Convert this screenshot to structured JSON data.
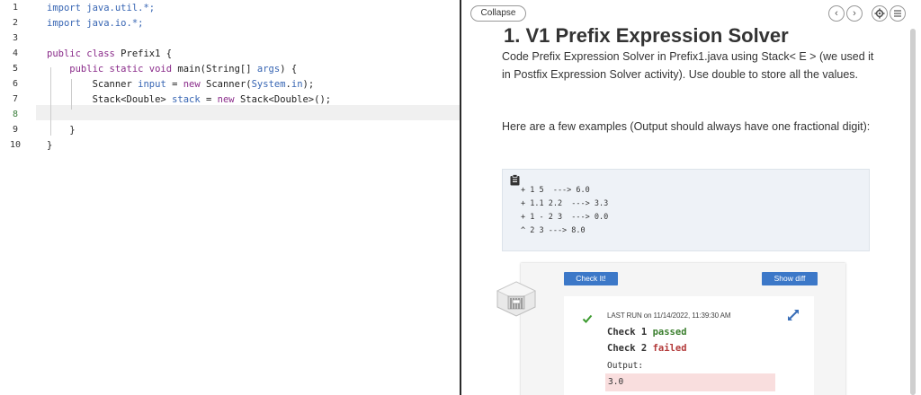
{
  "editor": {
    "line_numbers": [
      "1",
      "2",
      "3",
      "4",
      "5",
      "6",
      "7",
      "8",
      "9",
      "10"
    ],
    "active_line": "8",
    "lines": [
      [
        {
          "t": "import java.util.*;",
          "c": "id"
        }
      ],
      [
        {
          "t": "import java.io.*;",
          "c": "id"
        }
      ],
      [],
      [
        {
          "t": "public class",
          "c": "kw"
        },
        {
          "t": " Prefix1 {",
          "c": ""
        }
      ],
      [
        {
          "t": "    public static void",
          "c": "kw"
        },
        {
          "t": " main(String[] ",
          "c": ""
        },
        {
          "t": "args",
          "c": "id"
        },
        {
          "t": ") {",
          "c": ""
        }
      ],
      [
        {
          "t": "        Scanner ",
          "c": ""
        },
        {
          "t": "input",
          "c": "id"
        },
        {
          "t": " = ",
          "c": ""
        },
        {
          "t": "new",
          "c": "kw"
        },
        {
          "t": " Scanner(",
          "c": ""
        },
        {
          "t": "System",
          "c": "id"
        },
        {
          "t": ".",
          "c": ""
        },
        {
          "t": "in",
          "c": "id"
        },
        {
          "t": ");",
          "c": ""
        }
      ],
      [
        {
          "t": "        Stack<Double> ",
          "c": ""
        },
        {
          "t": "stack",
          "c": "id"
        },
        {
          "t": " = ",
          "c": ""
        },
        {
          "t": "new",
          "c": "kw"
        },
        {
          "t": " Stack<Double>();",
          "c": ""
        }
      ],
      [],
      [
        {
          "t": "    }",
          "c": ""
        }
      ],
      [
        {
          "t": "}",
          "c": ""
        }
      ]
    ]
  },
  "panel": {
    "collapse_label": "Collapse",
    "nav_prev": "‹",
    "nav_next": "›",
    "title": "1. V1 Prefix Expression Solver",
    "description": "Code Prefix Expression Solver in Prefix1.java using Stack< E > (we used it in Postfix Expression Solver activity). Use double to store all the values.",
    "examples_intro": "Here are a few examples (Output should always have one fractional digit):",
    "examples": [
      "+ 1 5  ---> 6.0",
      "+ 1.1 2.2  ---> 3.3",
      "+ 1 - 2 3  ---> 0.0",
      "^ 2 3 ---> 8.0"
    ],
    "check_button": "Check It!",
    "diff_button": "Show diff",
    "last_run_label": "LAST RUN on 11/14/2022, 11:39:30 AM",
    "results": [
      {
        "label": "Check 1",
        "status": "passed"
      },
      {
        "label": "Check 2",
        "status": "failed"
      }
    ],
    "output_label": "Output:",
    "output_value": "3.0"
  },
  "colors": {
    "accent_button": "#3c78c8",
    "pass": "#3b7f2e",
    "fail": "#b33a3a",
    "keyword": "#8a2b8a",
    "identifier": "#3765b3"
  },
  "icons": {
    "settings": "gear-icon",
    "menu": "list-icon",
    "copy": "clipboard-icon",
    "status": "checkmark-icon",
    "expand": "expand-arrows-icon"
  }
}
